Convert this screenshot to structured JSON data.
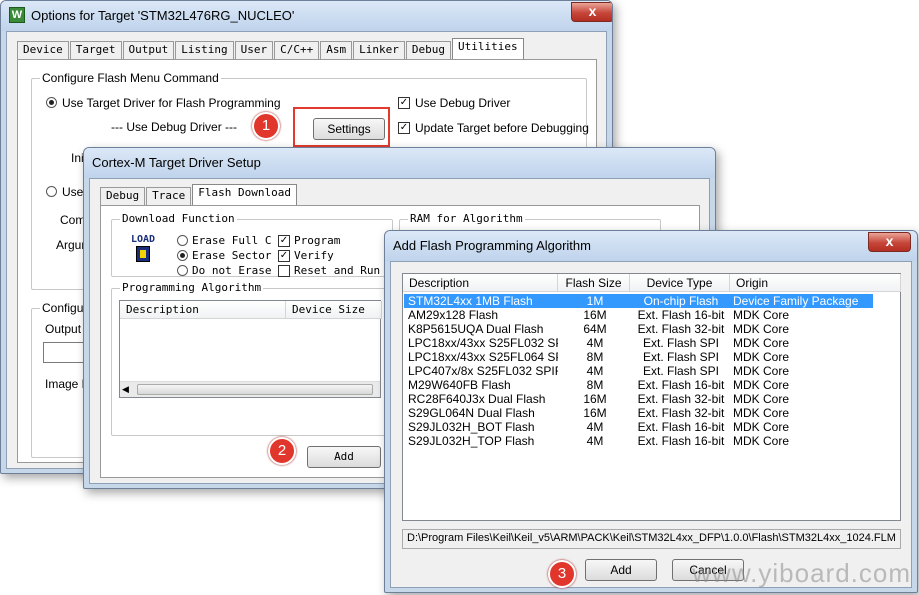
{
  "options_window": {
    "title": "Options for Target 'STM32L476RG_NUCLEO'",
    "close": "x",
    "tabs": [
      "Device",
      "Target",
      "Output",
      "Listing",
      "User",
      "C/C++",
      "Asm",
      "Linker",
      "Debug",
      "Utilities"
    ],
    "active_tab": "Utilities",
    "group_flash": "Configure Flash Menu Command",
    "radio_target_driver": "Use Target Driver for Flash Programming",
    "use_debug_driver_dashes": "--- Use Debug Driver ---",
    "settings_button": "Settings",
    "chk_use_debug_driver": "Use Debug Driver",
    "chk_update_target": "Update Target before Debugging",
    "label_init_partial": "Init",
    "radio_use_partial": "Use",
    "label_comm_partial": "Comm",
    "label_argum_partial": "Argum",
    "group_configure_partial": "Configure",
    "label_output_partial": "Output F",
    "label_image_partial": "Image Fi"
  },
  "cortex_window": {
    "title": "Cortex-M Target Driver Setup",
    "tabs": [
      "Debug",
      "Trace",
      "Flash Download"
    ],
    "active_tab": "Flash Download",
    "group_download": "Download Function",
    "load_icon_text": "LOAD",
    "radio_erase_full": "Erase Full C",
    "radio_erase_sector": "Erase Sector",
    "radio_do_not_erase": "Do not Erase",
    "chk_program": "Program",
    "chk_verify": "Verify",
    "chk_reset_run": "Reset and Run",
    "group_ram": "RAM for Algorithm",
    "group_prog_algo": "Programming Algorithm",
    "col_description": "Description",
    "col_device_size": "Device Size",
    "add_button": "Add"
  },
  "add_algo_window": {
    "title": "Add Flash Programming Algorithm",
    "close": "x",
    "columns": [
      "Description",
      "Flash Size",
      "Device Type",
      "Origin"
    ],
    "rows": [
      [
        "STM32L4xx 1MB Flash",
        "1M",
        "On-chip Flash",
        "Device Family Package"
      ],
      [
        "AM29x128 Flash",
        "16M",
        "Ext. Flash 16-bit",
        "MDK Core"
      ],
      [
        "K8P5615UQA Dual Flash",
        "64M",
        "Ext. Flash 32-bit",
        "MDK Core"
      ],
      [
        "LPC18xx/43xx S25FL032 SP...",
        "4M",
        "Ext. Flash SPI",
        "MDK Core"
      ],
      [
        "LPC18xx/43xx S25FL064 SP...",
        "8M",
        "Ext. Flash SPI",
        "MDK Core"
      ],
      [
        "LPC407x/8x S25FL032 SPIFI",
        "4M",
        "Ext. Flash SPI",
        "MDK Core"
      ],
      [
        "M29W640FB Flash",
        "8M",
        "Ext. Flash 16-bit",
        "MDK Core"
      ],
      [
        "RC28F640J3x Dual Flash",
        "16M",
        "Ext. Flash 32-bit",
        "MDK Core"
      ],
      [
        "S29GL064N Dual Flash",
        "16M",
        "Ext. Flash 32-bit",
        "MDK Core"
      ],
      [
        "S29JL032H_BOT Flash",
        "4M",
        "Ext. Flash 16-bit",
        "MDK Core"
      ],
      [
        "S29JL032H_TOP Flash",
        "4M",
        "Ext. Flash 16-bit",
        "MDK Core"
      ]
    ],
    "selected_row": 0,
    "path": "D:\\Program Files\\Keil\\Keil_v5\\ARM\\PACK\\Keil\\STM32L4xx_DFP\\1.0.0\\Flash\\STM32L4xx_1024.FLM",
    "add_button": "Add",
    "cancel_button": "Cancel"
  },
  "badges": [
    "1",
    "2",
    "3"
  ],
  "watermark": "www.yiboard.com",
  "colors": {
    "highlight": "#e23b2e",
    "selection": "#3399ff",
    "badge": "#e0362b"
  }
}
